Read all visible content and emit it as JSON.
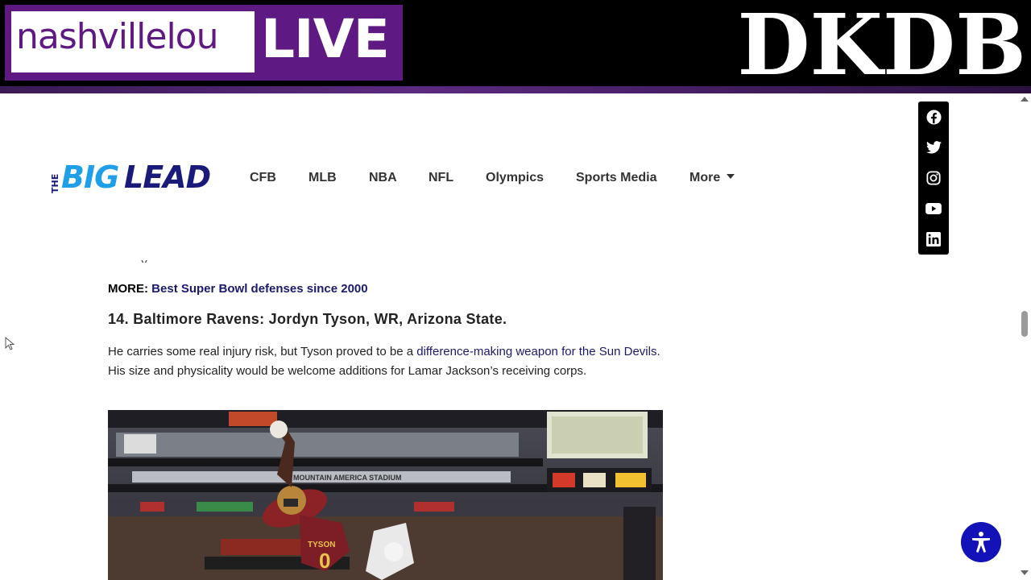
{
  "banner": {
    "brand_name": "nashvillelou",
    "brand_live": "LIVE",
    "right_logo": "DKDB"
  },
  "site": {
    "logo_the": "THE",
    "logo_big": "BIG",
    "logo_lead": "LEAD"
  },
  "nav": {
    "items": [
      "CFB",
      "MLB",
      "NBA",
      "NFL",
      "Olympics",
      "Sports Media",
      "More"
    ]
  },
  "social": {
    "icons": [
      "facebook-icon",
      "twitter-icon",
      "instagram-icon",
      "youtube-icon",
      "linkedin-icon"
    ]
  },
  "article": {
    "more_prefix": "MORE:",
    "more_link": "Best Super Bowl defenses since 2000",
    "heading": "14. Baltimore Ravens: Jordyn Tyson, WR, Arizona State.",
    "para_before": "He carries some real injury risk, but Tyson proved to be a ",
    "para_link": "difference-making weapon for the Sun Devils",
    "para_after": ". His size and physicality would be welcome additions for Lamar Jackson’s receiving corps.",
    "photo_jersey_name": "TYSON",
    "photo_jersey_number": "0",
    "photo_stadium_sign": "MOUNTAIN AMERICA STADIUM"
  },
  "colors": {
    "brand_purple": "#5e1a82",
    "logo_blue": "#1e9fe8",
    "logo_navy": "#1a1a7a",
    "link": "#1a1a6e",
    "accessibility_button": "#1212b8"
  }
}
